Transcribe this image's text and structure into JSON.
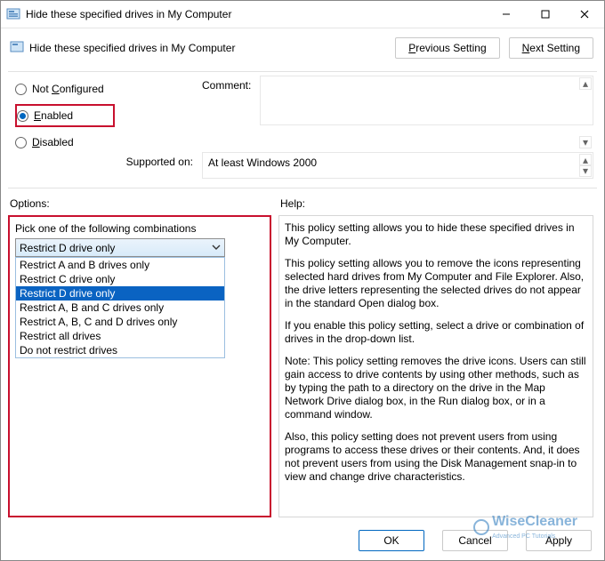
{
  "titlebar": {
    "title": "Hide these specified drives in My Computer"
  },
  "header": {
    "title": "Hide these specified drives in My Computer",
    "prev": "Previous Setting",
    "next": "Next Setting"
  },
  "state": {
    "not_configured": "Not Configured",
    "enabled": "Enabled",
    "disabled": "Disabled"
  },
  "labels": {
    "comment": "Comment:",
    "supported_on": "Supported on:",
    "options": "Options:",
    "help": "Help:"
  },
  "supported_text": "At least Windows 2000",
  "options_panel": {
    "prompt": "Pick one of the following combinations",
    "selected": "Restrict D drive only",
    "items": [
      "Restrict A and B drives only",
      "Restrict C drive only",
      "Restrict D drive only",
      "Restrict A, B and C drives only",
      "Restrict A, B, C and D drives only",
      "Restrict all drives",
      "Do not restrict drives"
    ]
  },
  "help_text": {
    "p1": "This policy setting allows you to hide these specified drives in My Computer.",
    "p2": "This policy setting allows you to remove the icons representing selected hard drives from My Computer and File Explorer. Also, the drive letters representing the selected drives do not appear in the standard Open dialog box.",
    "p3": "If you enable this policy setting, select a drive or combination of drives in the drop-down list.",
    "p4": "Note: This policy setting removes the drive icons. Users can still gain access to drive contents by using other methods, such as by typing the path to a directory on the drive in the Map Network Drive dialog box, in the Run dialog box, or in a command window.",
    "p5": "Also, this policy setting does not prevent users from using programs to access these drives or their contents. And, it does not prevent users from using the Disk Management snap-in to view and change drive characteristics."
  },
  "buttons": {
    "ok": "OK",
    "cancel": "Cancel",
    "apply": "Apply"
  },
  "watermark": {
    "brand": "WiseCleaner",
    "tag": "Advanced PC Tutorials"
  }
}
